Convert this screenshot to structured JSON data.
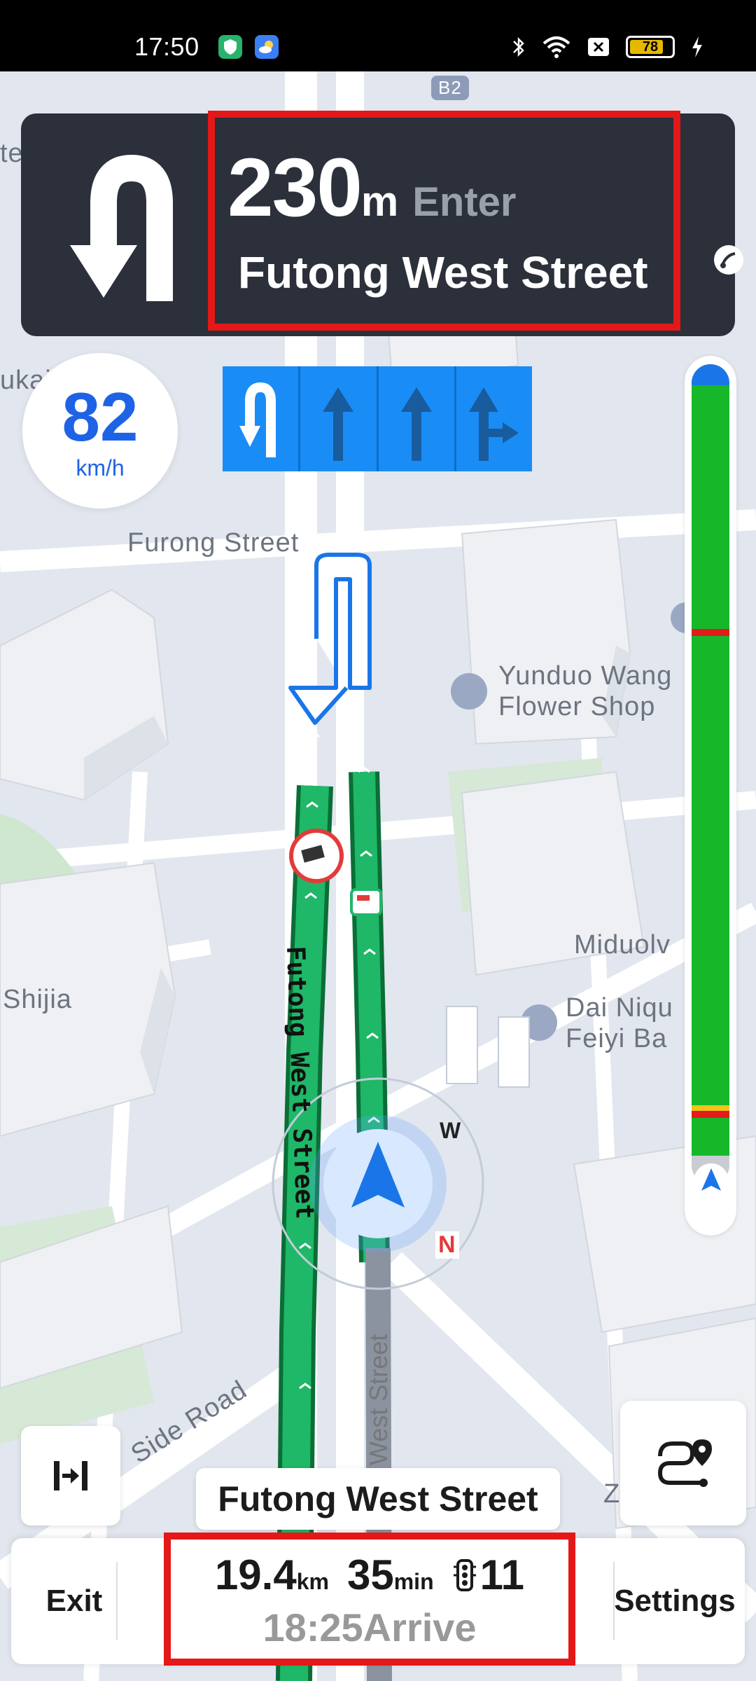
{
  "status_bar": {
    "time": "17:50",
    "battery_level": "78",
    "icons": [
      "shield-app-icon",
      "weather-app-icon",
      "bluetooth-icon",
      "wifi-icon",
      "no-sim-icon",
      "battery-icon",
      "charging-icon"
    ]
  },
  "instruction": {
    "distance_value": "230",
    "distance_unit": "m",
    "action": "Enter",
    "street": "Futong West Street",
    "turn_icon": "u-turn-icon"
  },
  "speed": {
    "value": "82",
    "unit": "km/h"
  },
  "lanes": [
    "u-turn-left",
    "straight",
    "straight",
    "straight-right"
  ],
  "route_progress": {
    "traveled_fraction": 0.96
  },
  "map_labels": {
    "top_badge": "B2",
    "furong_street": "Furong Street",
    "yunduo_line1": "Yunduo Wang",
    "yunduo_line2": "Flower Shop",
    "miduolv": "Miduolv",
    "shijia": "Shijia",
    "dai_line1": "Dai Niqu",
    "dai_line2": "Feiyi Ba",
    "futong_west_street_vertical": "Futong West Street",
    "west_street_vertical": "West Street",
    "side_road": "Side Road",
    "compass_w": "W",
    "compass_n": "N",
    "partial_ukai": "ukai",
    "partial_left_te": "te",
    "partial_z": "Z"
  },
  "current_road": "Futong West Street",
  "trip": {
    "distance": "19.4",
    "distance_unit": "km",
    "duration": "35",
    "duration_unit": "min",
    "traffic_lights": "11",
    "arrive_time": "18:25",
    "arrive_label": "Arrive"
  },
  "buttons": {
    "exit": "Exit",
    "settings": "Settings"
  },
  "colors": {
    "route_green": "#16b82a",
    "route_blue": "#1a76e8",
    "panel_dark": "#2b303b",
    "highlight_red": "#e41818",
    "lane_blue": "#1a8cf6"
  }
}
